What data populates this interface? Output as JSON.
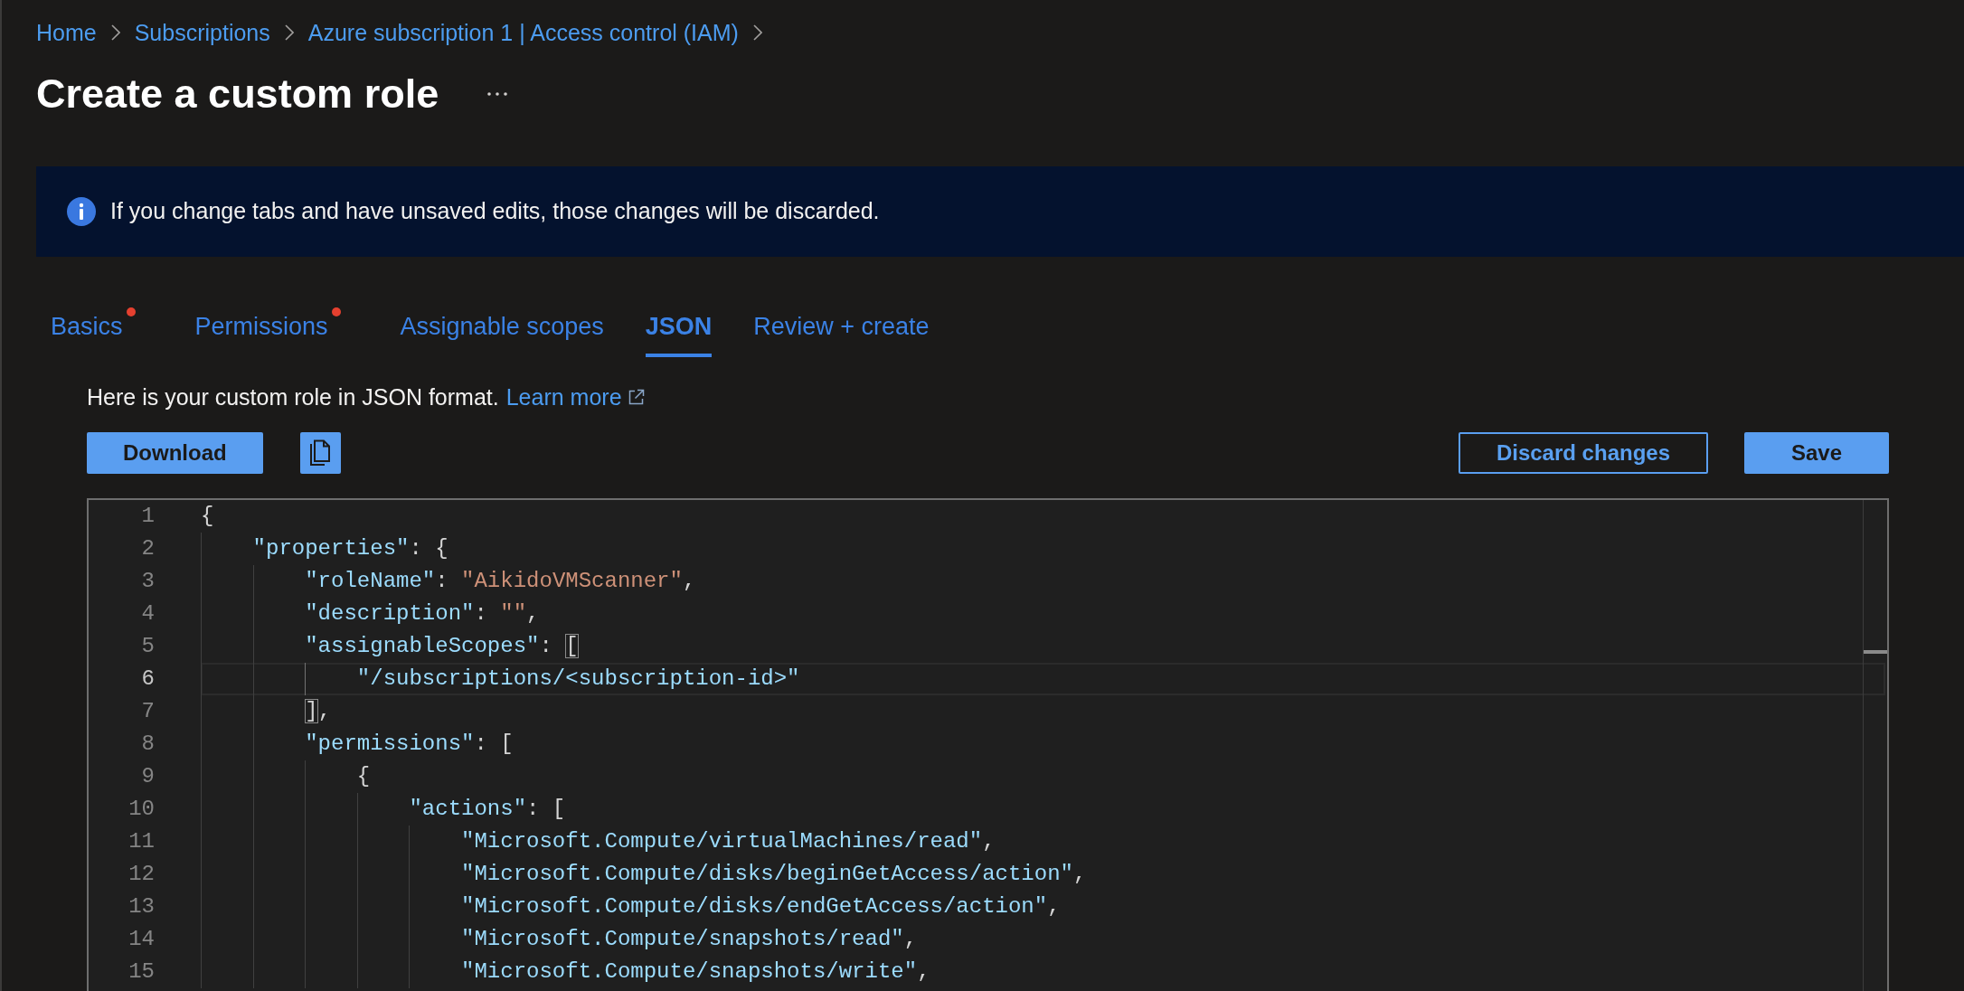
{
  "breadcrumb": [
    "Home",
    "Subscriptions",
    "Azure subscription 1 | Access control (IAM)"
  ],
  "title": "Create a custom role",
  "banner": {
    "message": "If you change tabs and have unsaved edits, those changes will be discarded."
  },
  "tabs": [
    {
      "label": "Basics",
      "selected": false,
      "error_dot": true
    },
    {
      "label": "Permissions",
      "selected": false,
      "error_dot": true
    },
    {
      "label": "Assignable scopes",
      "selected": false,
      "error_dot": false
    },
    {
      "label": "JSON",
      "selected": true,
      "error_dot": false
    },
    {
      "label": "Review + create",
      "selected": false,
      "error_dot": false
    }
  ],
  "description": {
    "text": "Here is your custom role in JSON format.",
    "link": "Learn more"
  },
  "toolbar": {
    "left": [
      {
        "kind": "primary",
        "label": "Download"
      },
      {
        "kind": "icon"
      }
    ],
    "right": [
      {
        "kind": "outline",
        "label": "Discard changes"
      },
      {
        "kind": "primary",
        "label": "Save"
      }
    ]
  },
  "editor": {
    "lines": [
      {
        "number": "1",
        "current": false,
        "tokens": [
          {
            "kind": "punct",
            "text": "{"
          }
        ]
      },
      {
        "number": "2",
        "current": false,
        "tokens": [
          {
            "kind": "key",
            "text": "\"properties\""
          },
          {
            "kind": "punct",
            "text": ": {"
          }
        ]
      },
      {
        "number": "3",
        "current": false,
        "tokens": [
          {
            "kind": "key",
            "text": "\"roleName\""
          },
          {
            "kind": "punct",
            "text": ": "
          },
          {
            "kind": "value",
            "text": "\"AikidoVMScanner\""
          },
          {
            "kind": "punct",
            "text": ","
          }
        ]
      },
      {
        "number": "4",
        "current": false,
        "tokens": [
          {
            "kind": "key",
            "text": "\"description\""
          },
          {
            "kind": "punct",
            "text": ": "
          },
          {
            "kind": "value",
            "text": "\"\""
          },
          {
            "kind": "punct",
            "text": ","
          }
        ]
      },
      {
        "number": "5",
        "current": false,
        "tokens": [
          {
            "kind": "key",
            "text": "\"assignableScopes\""
          },
          {
            "kind": "punct",
            "text": ": "
          },
          {
            "kind": "match",
            "text": "["
          }
        ]
      },
      {
        "number": "6",
        "current": true,
        "tokens": [
          {
            "kind": "item",
            "text": "\"/subscriptions/<subscription-id>\""
          }
        ]
      },
      {
        "number": "7",
        "current": false,
        "tokens": [
          {
            "kind": "match",
            "text": "]"
          },
          {
            "kind": "punct",
            "text": ","
          }
        ]
      },
      {
        "number": "8",
        "current": false,
        "tokens": [
          {
            "kind": "key",
            "text": "\"permissions\""
          },
          {
            "kind": "punct",
            "text": ": ["
          }
        ]
      },
      {
        "number": "9",
        "current": false,
        "tokens": [
          {
            "kind": "punct",
            "text": "{"
          }
        ]
      },
      {
        "number": "10",
        "current": false,
        "tokens": [
          {
            "kind": "key",
            "text": "\"actions\""
          },
          {
            "kind": "punct",
            "text": ": ["
          }
        ]
      },
      {
        "number": "11",
        "current": false,
        "tokens": [
          {
            "kind": "item",
            "text": "\"Microsoft.Compute/virtualMachines/read\""
          },
          {
            "kind": "punct",
            "text": ","
          }
        ]
      },
      {
        "number": "12",
        "current": false,
        "tokens": [
          {
            "kind": "item",
            "text": "\"Microsoft.Compute/disks/beginGetAccess/action\""
          },
          {
            "kind": "punct",
            "text": ","
          }
        ]
      },
      {
        "number": "13",
        "current": false,
        "tokens": [
          {
            "kind": "item",
            "text": "\"Microsoft.Compute/disks/endGetAccess/action\""
          },
          {
            "kind": "punct",
            "text": ","
          }
        ]
      },
      {
        "number": "14",
        "current": false,
        "tokens": [
          {
            "kind": "item",
            "text": "\"Microsoft.Compute/snapshots/read\""
          },
          {
            "kind": "punct",
            "text": ","
          }
        ]
      },
      {
        "number": "15",
        "current": false,
        "tokens": [
          {
            "kind": "item",
            "text": "\"Microsoft.Compute/snapshots/write\""
          },
          {
            "kind": "punct",
            "text": ","
          }
        ]
      }
    ]
  }
}
